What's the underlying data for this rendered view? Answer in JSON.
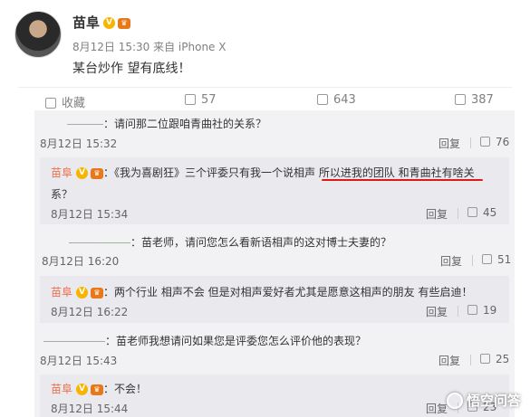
{
  "post": {
    "author": "苗阜",
    "meta": "8月12日 15:30 来自 iPhone X",
    "text": "某台炒作 望有底线！",
    "actions": {
      "favorite_label": "收藏",
      "forward_count": "57",
      "comment_count": "643",
      "like_count": "387"
    }
  },
  "comments": [
    {
      "text": "：请问那二位跟咱青曲社的关系？",
      "time": "8月12日 15:32",
      "reply": "回复",
      "likes": "76"
    },
    {
      "name": "苗阜",
      "text": "：《我为喜剧狂》三个评委只有我一个说相声 所以进我的团队 和青曲社有啥关",
      "text2": "系？",
      "time": "8月12日 15:34",
      "reply": "回复",
      "likes": "45"
    },
    {
      "text": "：苗老师，请问您怎么看新语相声的这对博士夫妻的？",
      "time": "8月12日 16:20",
      "reply": "回复",
      "likes": "51"
    },
    {
      "name": "苗阜",
      "text": "：两个行业 相声不会 但是对相声爱好者尤其是愿意这相声的朋友 有些启迪！",
      "time": "8月12日 16:22",
      "reply": "回复",
      "likes": "19"
    },
    {
      "text": "：苗老师我想请问如果您是评委您怎么评价他的表现？",
      "time": "8月12日 15:43",
      "reply": "回复",
      "likes": "25"
    },
    {
      "name": "苗阜",
      "text": "：不会！",
      "time": "8月12日 15:44",
      "reply": "回复",
      "likes": "23"
    }
  ],
  "watermark": "悟空问答",
  "colors": {
    "name": "#eb7350",
    "underline": "#e01818",
    "panel": "#f2f2f5"
  }
}
